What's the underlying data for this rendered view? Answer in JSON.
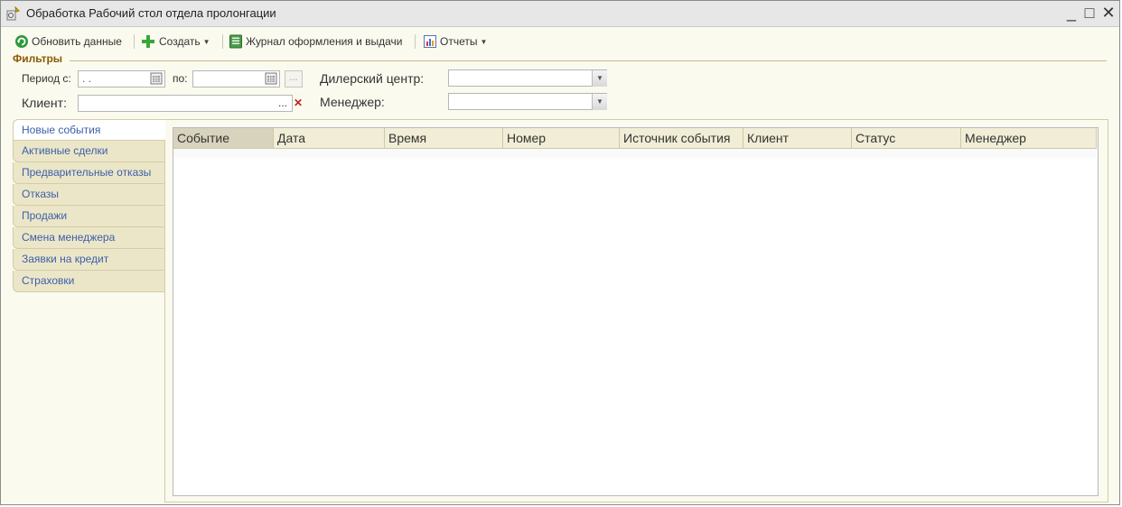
{
  "window": {
    "title": "Обработка Рабочий стол отдела пролонгации",
    "controls": {
      "minimize": "_",
      "maximize": "□",
      "close": "✕"
    }
  },
  "toolbar": {
    "refresh_label": "Обновить данные",
    "create_label": "Создать",
    "journal_label": "Журнал оформления и выдачи",
    "reports_label": "Отчеты"
  },
  "filters": {
    "title": "Фильтры",
    "period_from_label": "Период с:",
    "period_from_value": " .  .",
    "period_to_label": "по:",
    "period_to_value": "",
    "dealer_center_label": "Дилерский центр:",
    "dealer_center_value": "",
    "client_label": "Клиент:",
    "client_value": "",
    "manager_label": "Менеджер:",
    "manager_value": "",
    "ellipsis": "...",
    "clear": "✕"
  },
  "tabs": [
    {
      "label": "Новые события",
      "active": true
    },
    {
      "label": "Активные сделки",
      "active": false
    },
    {
      "label": "Предварительные отказы",
      "active": false
    },
    {
      "label": "Отказы",
      "active": false
    },
    {
      "label": "Продажи",
      "active": false
    },
    {
      "label": "Смена менеджера",
      "active": false
    },
    {
      "label": "Заявки на кредит",
      "active": false
    },
    {
      "label": "Страховки",
      "active": false
    }
  ],
  "grid": {
    "columns": [
      "Событие",
      "Дата",
      "Время",
      "Номер",
      "Источник события",
      "Клиент",
      "Статус",
      "Менеджер"
    ],
    "rows": []
  },
  "colors": {
    "accent": "#8a5a00",
    "tab_text": "#3b5fa8",
    "window_bg": "#fbfaee"
  }
}
